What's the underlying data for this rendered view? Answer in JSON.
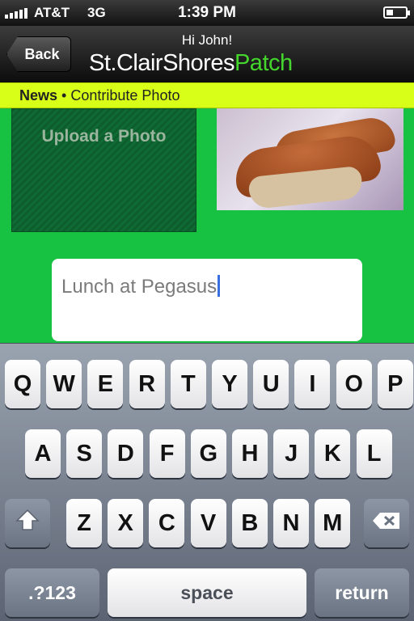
{
  "status_bar": {
    "carrier": "AT&T",
    "network": "3G",
    "time": "1:39 PM",
    "battery_level": 0.35
  },
  "header": {
    "back_label": "Back",
    "greeting": "Hi John!",
    "brand_main": "St.ClairShores",
    "brand_accent": "Patch"
  },
  "breadcrumb": {
    "section": "News",
    "separator": "•",
    "page": "Contribute Photo"
  },
  "main": {
    "upload_label": "Upload a Photo",
    "caption_value": "Lunch at Pegasus"
  },
  "keyboard": {
    "row1": [
      "Q",
      "W",
      "E",
      "R",
      "T",
      "Y",
      "U",
      "I",
      "O",
      "P"
    ],
    "row2": [
      "A",
      "S",
      "D",
      "F",
      "G",
      "H",
      "J",
      "K",
      "L"
    ],
    "row3": [
      "Z",
      "X",
      "C",
      "V",
      "B",
      "N",
      "M"
    ],
    "numbers_label": ".?123",
    "space_label": "space",
    "return_label": "return",
    "shift_icon": "shift-icon",
    "delete_icon": "backspace-icon"
  }
}
